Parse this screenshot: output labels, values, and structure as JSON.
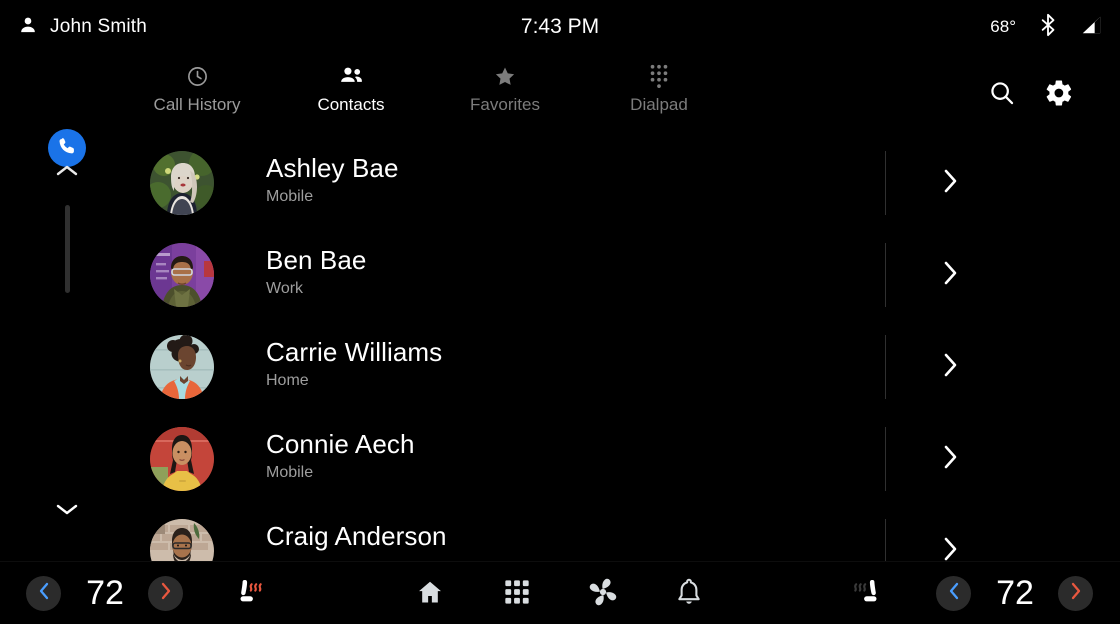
{
  "statusbar": {
    "user_icon": "person-icon",
    "user_name": "John Smith",
    "clock": "7:43 PM",
    "temperature": "68°",
    "bluetooth_icon": "bluetooth-icon",
    "signal_icon": "signal-bars-icon"
  },
  "app": {
    "badge_icon": "phone-icon",
    "accent_blue": "#1a73e8"
  },
  "tabs": [
    {
      "label": "Call History",
      "icon": "clock-icon",
      "state": "inactive"
    },
    {
      "label": "Contacts",
      "icon": "contacts-icon",
      "state": "active"
    },
    {
      "label": "Favorites",
      "icon": "star-icon",
      "state": "dim"
    },
    {
      "label": "Dialpad",
      "icon": "dialpad-icon",
      "state": "dim"
    }
  ],
  "actions": [
    {
      "name": "search-button",
      "icon": "search-icon"
    },
    {
      "name": "settings-button",
      "icon": "gear-icon"
    }
  ],
  "scrollbar": {
    "up_icon": "chevron-up-icon",
    "down_icon": "chevron-down-icon"
  },
  "contacts": [
    {
      "name": "Ashley Bae",
      "label": "Mobile",
      "avatar": "woman-blonde-foliage",
      "chevron": "chevron-right-icon"
    },
    {
      "name": "Ben Bae",
      "label": "Work",
      "avatar": "man-glasses-purple",
      "chevron": "chevron-right-icon"
    },
    {
      "name": "Carrie Williams",
      "label": "Home",
      "avatar": "woman-afro-orange",
      "chevron": "chevron-right-icon"
    },
    {
      "name": "Connie Aech",
      "label": "Mobile",
      "avatar": "woman-yellow-red",
      "chevron": "chevron-right-icon"
    },
    {
      "name": "Craig Anderson",
      "label": "",
      "avatar": "man-beard-brick",
      "chevron": "chevron-right-icon"
    }
  ],
  "climate": {
    "left": {
      "decrease_icon": "chevron-left-icon",
      "value": "72",
      "increase_icon": "chevron-right-icon",
      "decrease_color": "#4a9eff",
      "increase_color": "#e8573f"
    },
    "right": {
      "decrease_icon": "chevron-left-icon",
      "value": "72",
      "increase_icon": "chevron-right-icon",
      "decrease_color": "#4a9eff",
      "increase_color": "#e8573f"
    },
    "seat_left": {
      "icon": "heated-seat-icon",
      "state": "on",
      "wave_color": "#e8573f"
    },
    "seat_right": {
      "icon": "heated-seat-icon",
      "state": "off",
      "wave_color": "#3a3a3a"
    }
  },
  "navbar": [
    {
      "name": "home-button",
      "icon": "home-icon"
    },
    {
      "name": "apps-button",
      "icon": "apps-grid-icon"
    },
    {
      "name": "climate-fan-button",
      "icon": "fan-icon"
    },
    {
      "name": "notifications-button",
      "icon": "bell-icon"
    }
  ]
}
